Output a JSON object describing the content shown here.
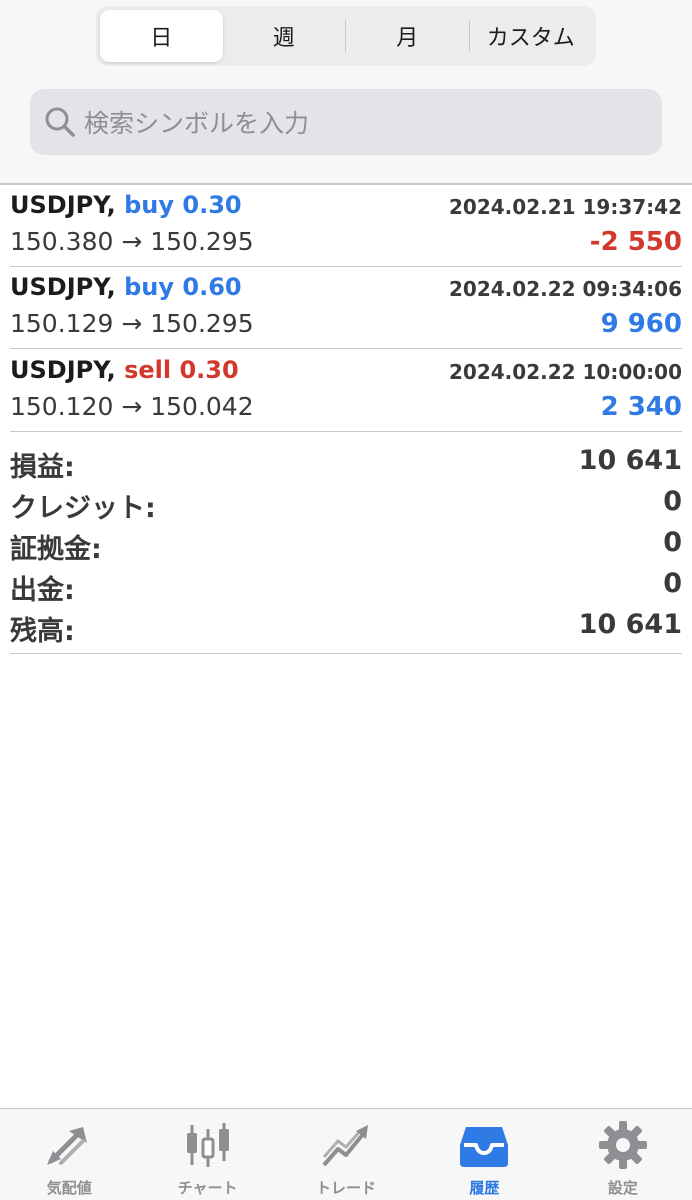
{
  "period_tabs": [
    "日",
    "週",
    "月",
    "カスタム"
  ],
  "active_period_index": 0,
  "search": {
    "placeholder": "検索シンボルを入力"
  },
  "trades": [
    {
      "symbol": "USDJPY,",
      "side": "buy 0.30",
      "side_type": "buy",
      "time": "2024.02.21 19:37:42",
      "prices": "150.380 → 150.295",
      "profit": "-2 550",
      "profit_type": "neg"
    },
    {
      "symbol": "USDJPY,",
      "side": "buy 0.60",
      "side_type": "buy",
      "time": "2024.02.22 09:34:06",
      "prices": "150.129 → 150.295",
      "profit": "9 960",
      "profit_type": "pos"
    },
    {
      "symbol": "USDJPY,",
      "side": "sell 0.30",
      "side_type": "sell",
      "time": "2024.02.22 10:00:00",
      "prices": "150.120 → 150.042",
      "profit": "2 340",
      "profit_type": "pos"
    }
  ],
  "summary": [
    {
      "label": "損益:",
      "value": "10 641"
    },
    {
      "label": "クレジット:",
      "value": "0"
    },
    {
      "label": "証拠金:",
      "value": "0"
    },
    {
      "label": "出金:",
      "value": "0"
    },
    {
      "label": "残高:",
      "value": "10 641"
    }
  ],
  "tabbar": [
    {
      "label": "気配値",
      "icon": "quotes-arrows-icon"
    },
    {
      "label": "チャート",
      "icon": "candlestick-chart-icon"
    },
    {
      "label": "トレード",
      "icon": "trade-trend-icon"
    },
    {
      "label": "履歴",
      "icon": "history-inbox-icon",
      "active": true
    },
    {
      "label": "設定",
      "icon": "gear-icon"
    }
  ],
  "colors": {
    "buy": "#2f7ae5",
    "sell": "#d0392b",
    "active_tab": "#2f7ae5",
    "inactive_tab": "#8e8e93"
  }
}
